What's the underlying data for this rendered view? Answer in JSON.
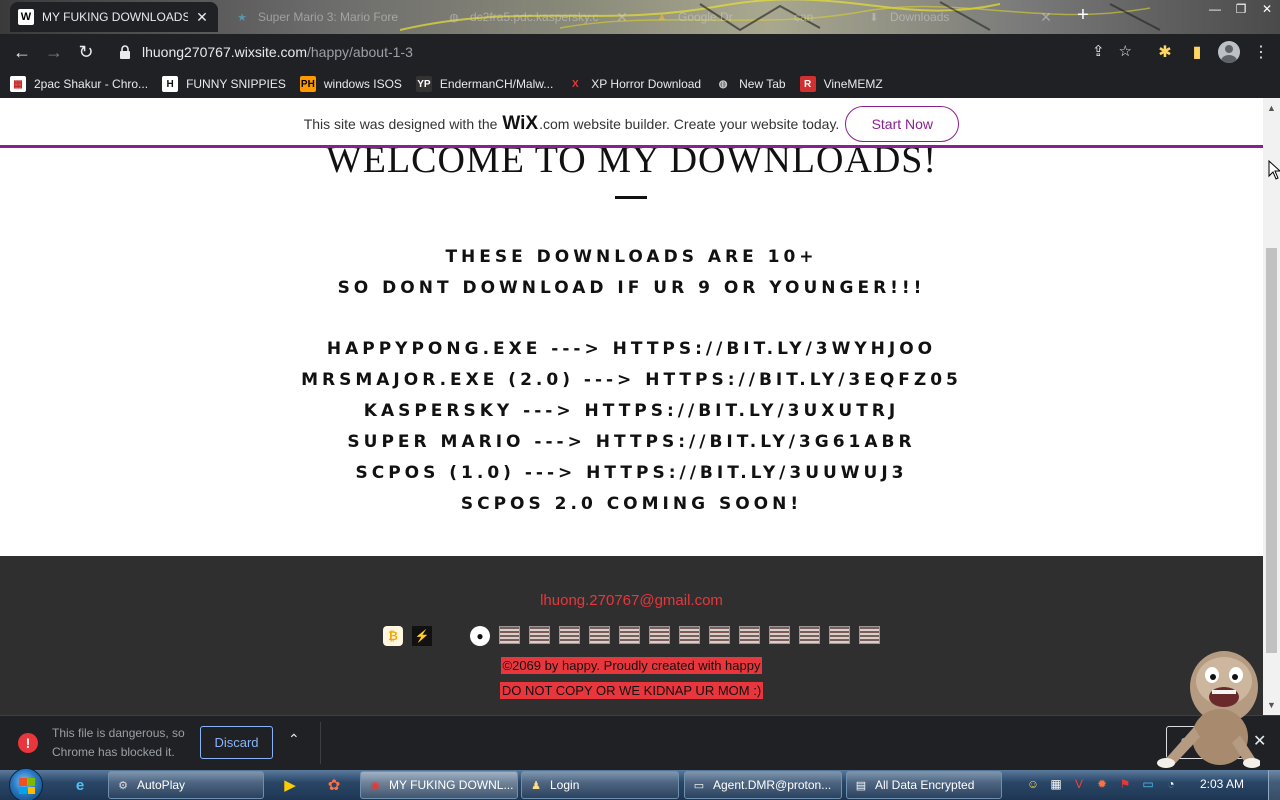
{
  "browser": {
    "tabs": [
      {
        "title": "MY FUKING DOWNLOADS |",
        "active": true,
        "favicon": "wix-favicon"
      },
      {
        "title": "Super Mario 3: Mario Fore",
        "active": false,
        "favicon": "star-favicon"
      },
      {
        "title": "dc2fra5.pdc.kaspersky.c",
        "active": false,
        "favicon": "globe-favicon"
      },
      {
        "title": "Google Dr",
        "active": false,
        "favicon": "drive-favicon"
      },
      {
        "title": "can",
        "active": false,
        "favicon": "page-favicon"
      },
      {
        "title": "Downloads",
        "active": false,
        "favicon": "download-favicon"
      }
    ],
    "new_tab_symbol": "+",
    "url_host": "lhuong270767.wixsite.com",
    "url_path": "/happy/about-1-3",
    "bookmarks": [
      {
        "label": "2pac Shakur - Chro...",
        "icon": "calendar-icon",
        "icon_bg": "#ffffff",
        "icon_color": "#c62828",
        "glyph": "▦"
      },
      {
        "label": "FUNNY SNIPPIES",
        "icon": "h-logo-icon",
        "icon_bg": "#ffffff",
        "icon_color": "#111111",
        "glyph": "H"
      },
      {
        "label": "windows ISOS",
        "icon": "ph-logo-icon",
        "icon_bg": "#ff9900",
        "icon_color": "#000000",
        "glyph": "PH"
      },
      {
        "label": "EndermanCH/Malw...",
        "icon": "yp-logo-icon",
        "icon_bg": "#333333",
        "icon_color": "#ffffff",
        "glyph": "YP"
      },
      {
        "label": "XP Horror Download",
        "icon": "x-logo-icon",
        "icon_bg": "transparent",
        "icon_color": "#e53935",
        "glyph": "X"
      },
      {
        "label": "New Tab",
        "icon": "globe-icon",
        "icon_bg": "transparent",
        "icon_color": "#cccccc",
        "glyph": "◍"
      },
      {
        "label": "VineMEMZ",
        "icon": "r-logo-icon",
        "icon_bg": "#d32f2f",
        "icon_color": "#ffffff",
        "glyph": "R"
      }
    ]
  },
  "wix_banner": {
    "prefix": "This site was designed with the",
    "logo": "WiX",
    "domain": ".com",
    "suffix": "website builder. Create your website today.",
    "button": "Start Now"
  },
  "page": {
    "heading": "WELCOME TO MY DOWNLOADS!",
    "warning_lines": [
      "THESE DOWNLOADS ARE 10+",
      "SO DONT DOWNLOAD IF UR 9 OR YOUNGER!!!"
    ],
    "download_lines": [
      "HAPPYPONG.EXE ---> HTTPS://BIT.LY/3WYHJOO",
      "MRSMAJOR.EXE (2.0) ---> HTTPS://BIT.LY/3EQFZ05",
      "KASPERSKY ---> HTTPS://BIT.LY/3UXUTRJ",
      "SUPER MARIO ---> HTTPS://BIT.LY/3G61ABR",
      "SCPOS (1.0) ---> HTTPS://BIT.LY/3UUWUJ3",
      "SCPOS 2.0 COMING SOON!"
    ]
  },
  "footer": {
    "email": "lhuong.270767@gmail.com",
    "copyright": "©2069 by happy. Proudly created with happy",
    "warning": "DO NOT COPY OR WE KIDNAP UR MOM :)",
    "social_icons": [
      {
        "name": "bitcoin-icon",
        "glyph": "₿",
        "color": "#f7a600",
        "broken": false
      },
      {
        "name": "trade-icon",
        "glyph": "⚡",
        "color": "#22c55e",
        "broken": false
      },
      {
        "name": "microsoft-icon",
        "glyph": "",
        "color": "",
        "broken": false
      },
      {
        "name": "github-icon",
        "glyph": "●",
        "color": "#111111",
        "broken": false
      },
      {
        "name": "broken-image-icon",
        "glyph": "",
        "color": "",
        "broken": true
      },
      {
        "name": "broken-image-icon",
        "glyph": "",
        "color": "",
        "broken": true
      },
      {
        "name": "broken-image-icon",
        "glyph": "",
        "color": "",
        "broken": true
      },
      {
        "name": "broken-image-icon",
        "glyph": "",
        "color": "",
        "broken": true
      },
      {
        "name": "broken-image-icon",
        "glyph": "",
        "color": "",
        "broken": true
      },
      {
        "name": "broken-image-icon",
        "glyph": "",
        "color": "",
        "broken": true
      },
      {
        "name": "broken-image-icon",
        "glyph": "",
        "color": "",
        "broken": true
      },
      {
        "name": "broken-image-icon",
        "glyph": "",
        "color": "",
        "broken": true
      },
      {
        "name": "broken-image-icon",
        "glyph": "",
        "color": "",
        "broken": true
      },
      {
        "name": "broken-image-icon",
        "glyph": "",
        "color": "",
        "broken": true
      },
      {
        "name": "broken-image-icon",
        "glyph": "",
        "color": "",
        "broken": true
      },
      {
        "name": "broken-image-icon",
        "glyph": "",
        "color": "",
        "broken": true
      },
      {
        "name": "broken-image-icon",
        "glyph": "",
        "color": "",
        "broken": true
      }
    ]
  },
  "download_shelf": {
    "message": "This file is dangerous, so Chrome has blocked it.",
    "discard": "Discard",
    "show_all": "Show all"
  },
  "taskbar": {
    "buttons": [
      {
        "label": "AutoPlay",
        "icon": "autoplay-icon",
        "glyph": "⚙",
        "active": false
      },
      {
        "label": "MY FUKING DOWNL...",
        "icon": "chrome-icon",
        "glyph": "◉",
        "active": true
      },
      {
        "label": "Login",
        "icon": "login-icon",
        "glyph": "♟",
        "active": false
      },
      {
        "label": "Agent.DMR@proton...",
        "icon": "window-icon",
        "glyph": "▭",
        "active": false
      },
      {
        "label": "All Data Encrypted",
        "icon": "drive-icon",
        "glyph": "▤",
        "active": false
      }
    ],
    "clock": "2:03 AM"
  },
  "colors": {
    "wix_purple": "#8a1f8f",
    "footer_bg": "#2f2f2f",
    "accent_red": "#e8363c",
    "chrome_dark": "#202124"
  }
}
